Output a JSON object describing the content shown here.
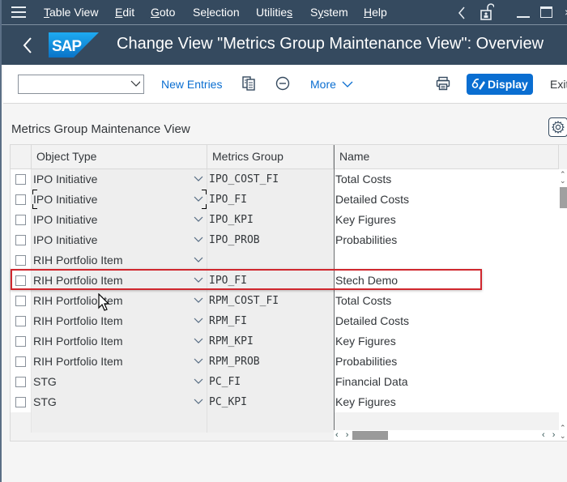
{
  "menubar": {
    "items": [
      {
        "label": "Table View",
        "underline": "T"
      },
      {
        "label": "Edit",
        "underline": "E"
      },
      {
        "label": "Goto",
        "underline": "G"
      },
      {
        "label": "Selection",
        "underline": "l"
      },
      {
        "label": "Utilities",
        "underline": "s"
      },
      {
        "label": "System",
        "underline": "y"
      },
      {
        "label": "Help",
        "underline": "H"
      }
    ],
    "icons": [
      "hamburger-icon",
      "chevron-left-icon",
      "unlock-icon",
      "minimize-icon",
      "maximize-icon"
    ]
  },
  "titlebar": {
    "logo_text": "SAP",
    "title": "Change View \"Metrics Group Maintenance View\": Overview"
  },
  "toolbar": {
    "command_field_value": "",
    "new_entries": "New Entries",
    "more": "More",
    "display": "Display",
    "exit": "Exit"
  },
  "section": {
    "title": "Metrics Group Maintenance View"
  },
  "table": {
    "columns": [
      "Object Type",
      "Metrics Group",
      "Name"
    ],
    "rows": [
      {
        "object_type": "IPO Initiative",
        "metrics_group": "IPO_COST_FI",
        "name": "Total Costs"
      },
      {
        "object_type": "IPO Initiative",
        "metrics_group": "IPO_FI",
        "name": "Detailed Costs"
      },
      {
        "object_type": "IPO Initiative",
        "metrics_group": "IPO_KPI",
        "name": "Key Figures"
      },
      {
        "object_type": "IPO Initiative",
        "metrics_group": "IPO_PROB",
        "name": "Probabilities"
      },
      {
        "object_type": "RIH Portfolio Item",
        "metrics_group": "",
        "name": ""
      },
      {
        "object_type": "RIH Portfolio Item",
        "metrics_group": "IPO_FI",
        "name": "Stech Demo"
      },
      {
        "object_type": "RIH Portfolio Item",
        "metrics_group": "RPM_COST_FI",
        "name": "Total Costs"
      },
      {
        "object_type": "RIH Portfolio Item",
        "metrics_group": "RPM_FI",
        "name": "Detailed Costs"
      },
      {
        "object_type": "RIH Portfolio Item",
        "metrics_group": "RPM_KPI",
        "name": "Key Figures"
      },
      {
        "object_type": "RIH Portfolio Item",
        "metrics_group": "RPM_PROB",
        "name": "Probabilities"
      },
      {
        "object_type": "STG",
        "metrics_group": "PC_FI",
        "name": "Financial Data"
      },
      {
        "object_type": "STG",
        "metrics_group": "PC_KPI",
        "name": "Key Figures"
      }
    ],
    "highlighted_row_index": 5,
    "focused_row_index": 1
  },
  "colors": {
    "shell": "#354a5f",
    "accent": "#0a6ed1",
    "highlight_border": "#d0272e"
  }
}
